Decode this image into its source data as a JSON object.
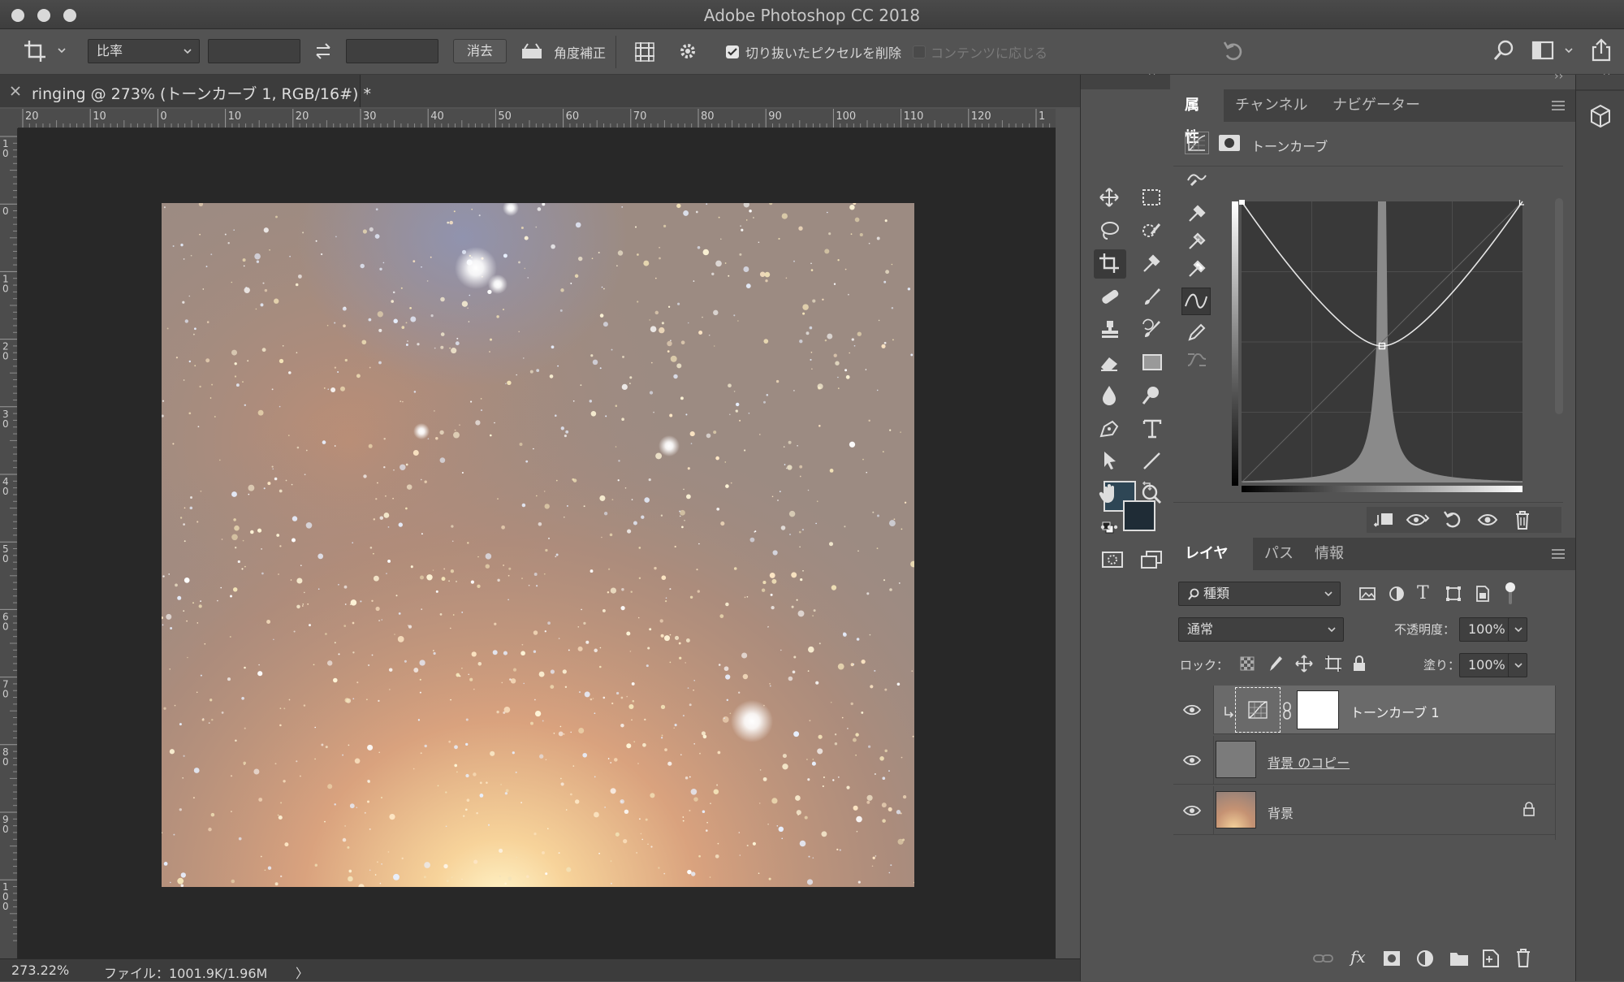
{
  "window": {
    "title": "Adobe Photoshop CC 2018"
  },
  "options_bar": {
    "ratio_label": "比率",
    "clear_label": "消去",
    "straighten_label": "角度補正",
    "delete_cropped_label": "切り抜いたピクセルを削除",
    "content_aware_label": "コンテンツに応じる"
  },
  "document": {
    "tab_title": "ringing @ 273% (トーンカーブ 1, RGB/16#) *"
  },
  "ruler": {
    "h_ticks": [
      "20",
      "10",
      "0",
      "10",
      "20",
      "30",
      "40",
      "50",
      "60",
      "70",
      "80",
      "90",
      "100",
      "110",
      "120",
      "1"
    ],
    "v_ticks": [
      "1\n0",
      "0",
      "1\n0",
      "2\n0",
      "3\n0",
      "4\n0",
      "5\n0",
      "6\n0",
      "7\n0",
      "8\n0",
      "9\n0",
      "1\n0\n0"
    ]
  },
  "status": {
    "zoom": "273.22%",
    "file_info": "ファイル：1001.9K/1.96M",
    "arrow": "〉"
  },
  "colors": {
    "foreground": "#2e4655",
    "background": "#1f2c36",
    "accent": "#ffffff"
  },
  "properties_panel": {
    "tabs": [
      "属性",
      "チャンネル",
      "ナビゲーター"
    ],
    "adjustment_label": "トーンカーブ"
  },
  "layers_panel": {
    "tabs": [
      "レイヤー",
      "パス",
      "情報"
    ],
    "filter_kind": "種類",
    "blend_mode": "通常",
    "opacity_label": "不透明度：",
    "opacity_value": "100%",
    "lock_label": "ロック：",
    "fill_label": "塗り：",
    "fill_value": "100%",
    "layers": [
      {
        "name": "トーンカーブ 1"
      },
      {
        "name": "背景 のコピー"
      },
      {
        "name": "背景"
      }
    ]
  },
  "icons": [
    "crop-icon",
    "swap-icon",
    "straighten-icon",
    "grid-icon",
    "gear-icon",
    "reset-icon",
    "search-icon",
    "workspace-icon",
    "share-icon",
    "move-icon",
    "marquee-icon",
    "lasso-icon",
    "quick-select-icon",
    "crop-tool-icon",
    "eyedropper-icon",
    "healing-icon",
    "brush-icon",
    "stamp-icon",
    "history-brush-icon",
    "eraser-icon",
    "gradient-icon",
    "blur-icon",
    "dodge-icon",
    "pen-icon",
    "type-icon",
    "path-select-icon",
    "line-icon",
    "hand-icon",
    "zoom-icon",
    "more-icon",
    "quick-mask-icon",
    "screen-mode-icon",
    "3d-icon",
    "eye-icon",
    "lock-icon",
    "link-icon",
    "fx-icon",
    "mask-icon",
    "adjustment-icon",
    "folder-icon",
    "new-layer-icon",
    "trash-icon"
  ]
}
